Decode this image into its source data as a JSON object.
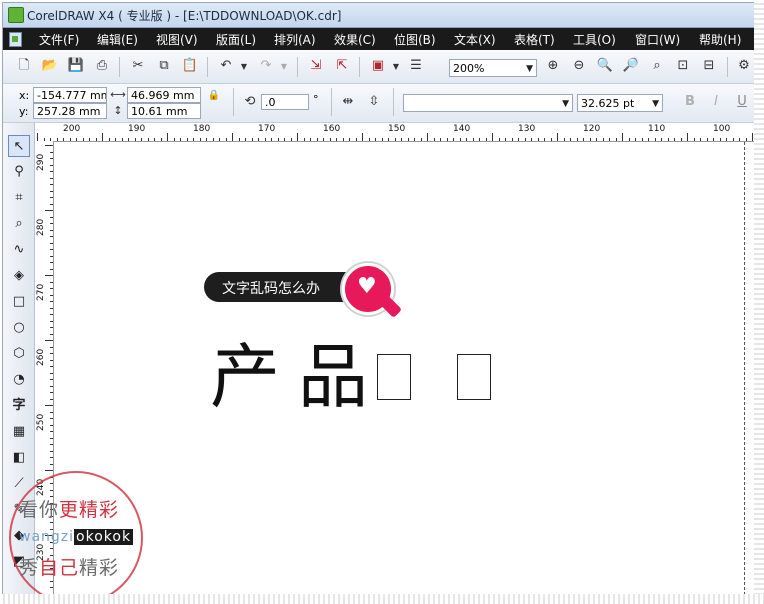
{
  "window": {
    "title": "CorelDRAW X4 ( 专业版 ) - [E:\\TDDOWNLOAD\\OK.cdr]"
  },
  "menu": [
    "文件(F)",
    "编辑(E)",
    "视图(V)",
    "版面(L)",
    "排列(A)",
    "效果(C)",
    "位图(B)",
    "文本(X)",
    "表格(T)",
    "工具(O)",
    "窗口(W)",
    "帮助(H)"
  ],
  "toolbar": {
    "zoom": "200%"
  },
  "property_bar": {
    "x_label": "x:",
    "x_value": "-154.777 mm",
    "y_label": "y:",
    "y_value": "257.28 mm",
    "width_value": "46.969 mm",
    "height_value": "10.61 mm",
    "rotation_value": ".0",
    "rotation_unit": "°",
    "font_name": "",
    "font_size": "32.625 pt",
    "bold": "B",
    "italic": "I",
    "underline": "U"
  },
  "rulers": {
    "horizontal": [
      "200",
      "190",
      "180",
      "170",
      "160",
      "150",
      "140",
      "130",
      "120",
      "110",
      "100"
    ],
    "vertical": [
      "290",
      "280",
      "270",
      "260",
      "250",
      "240",
      "230"
    ]
  },
  "canvas": {
    "text_chars": [
      "产",
      "品"
    ],
    "broken_glyph_count": 2,
    "callout_text": "文字乱码怎么办"
  },
  "watermark": {
    "line1_a": "看你",
    "line1_b": "更精彩",
    "line2_a": "wangzi",
    "line2_b": "okokok",
    "line3_a": "秀",
    "line3_b": "自己",
    "line3_c": "精彩"
  },
  "colors": {
    "accent": "#e8195a",
    "menu_bg": "#1a1a1a",
    "stamp": "#d1323e"
  }
}
